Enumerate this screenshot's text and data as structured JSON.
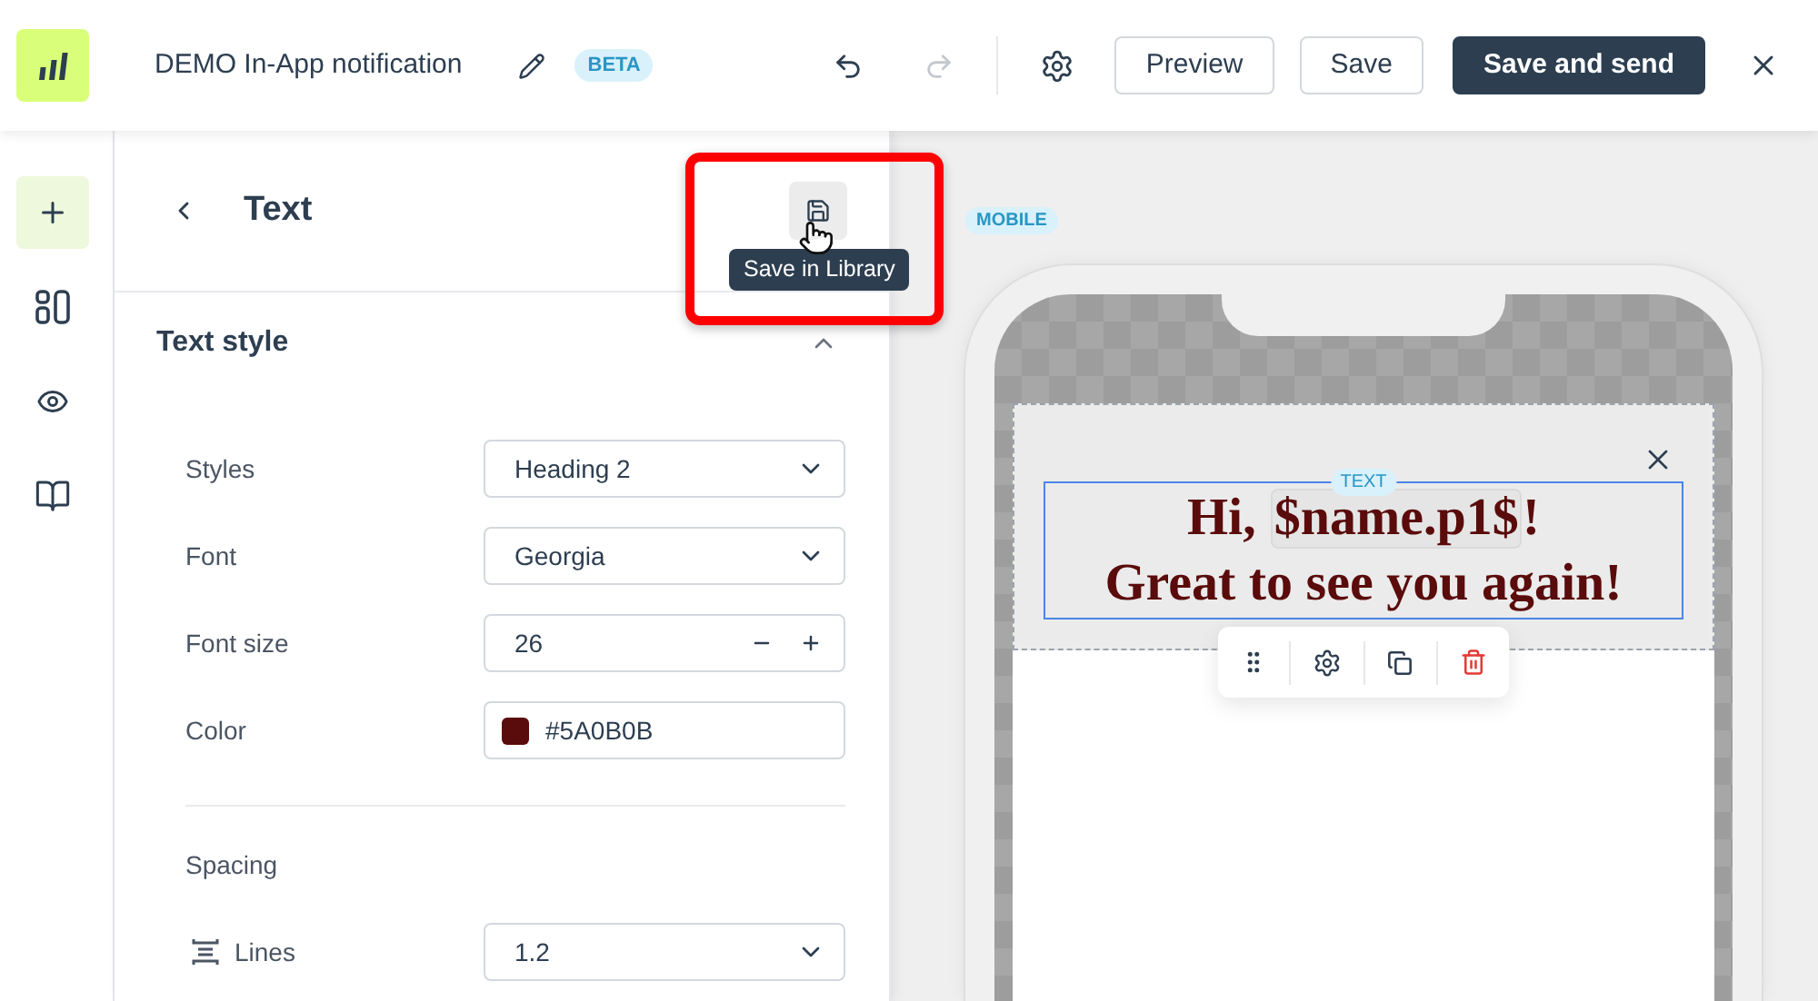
{
  "header": {
    "title": "DEMO In-App notification",
    "badge": "BETA",
    "history": [
      {
        "kind": "undo",
        "disabled": false
      },
      {
        "kind": "redo",
        "disabled": true
      }
    ],
    "buttons": [
      {
        "label": "Preview",
        "kind": "outline"
      },
      {
        "label": "Save",
        "kind": "outline"
      },
      {
        "label": "Save and send",
        "kind": "primary"
      }
    ]
  },
  "rail": {
    "items": [
      {
        "kind": "add",
        "selected": true
      },
      {
        "kind": "layout",
        "selected": false
      },
      {
        "kind": "preview",
        "selected": false
      },
      {
        "kind": "library",
        "selected": false
      }
    ]
  },
  "panel": {
    "title": "Text",
    "tooltip": "Save in Library",
    "section": {
      "title": "Text style",
      "expanded": true,
      "fields": [
        {
          "label": "Styles",
          "kind": "select",
          "value": "Heading 2"
        },
        {
          "label": "Font",
          "kind": "select",
          "value": "Georgia"
        },
        {
          "label": "Font size",
          "kind": "stepper",
          "value": "26"
        },
        {
          "label": "Color",
          "kind": "color",
          "value": "#5A0B0B"
        }
      ],
      "groups": [
        {
          "title": "Spacing",
          "fields": [
            {
              "label": "Lines",
              "kind": "line_height",
              "value": "1.2"
            }
          ]
        }
      ]
    }
  },
  "canvas": {
    "device_badge": "MOBILE",
    "text_block": {
      "label": "TEXT",
      "line_1_start": "Hi,",
      "merge_tag": "$name.p1$",
      "line_1_end": "!",
      "line_2": "Great to see you again!"
    }
  }
}
